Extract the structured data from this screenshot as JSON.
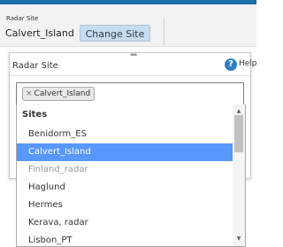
{
  "header": {
    "small_label": "Radar Site",
    "current_site": "Calvert_Island",
    "change_button": "Change Site"
  },
  "dialog": {
    "title": "Radar Site",
    "drag_handle": "▪▪▪",
    "help_label": "Help",
    "help_icon": "?"
  },
  "select": {
    "selected_chip": "Calvert_Island",
    "remove_glyph": "×"
  },
  "dropdown": {
    "group_label": "Sites",
    "options": [
      {
        "label": "Benidorm_ES",
        "state": "normal"
      },
      {
        "label": "Calvert_Island",
        "state": "highlighted"
      },
      {
        "label": "Finland_radar",
        "state": "disabled"
      },
      {
        "label": "Haglund",
        "state": "normal"
      },
      {
        "label": "Hermes",
        "state": "normal"
      },
      {
        "label": "Kerava, radar",
        "state": "normal"
      },
      {
        "label": "Lisbon_PT",
        "state": "normal"
      }
    ],
    "scroll_up_glyph": "▲",
    "scroll_down_glyph": "▼"
  },
  "colors": {
    "top_bar": "#1b6fa8",
    "highlight": "#5897fb",
    "button_bg": "#c7dcef",
    "help_icon": "#2f7fc1"
  }
}
